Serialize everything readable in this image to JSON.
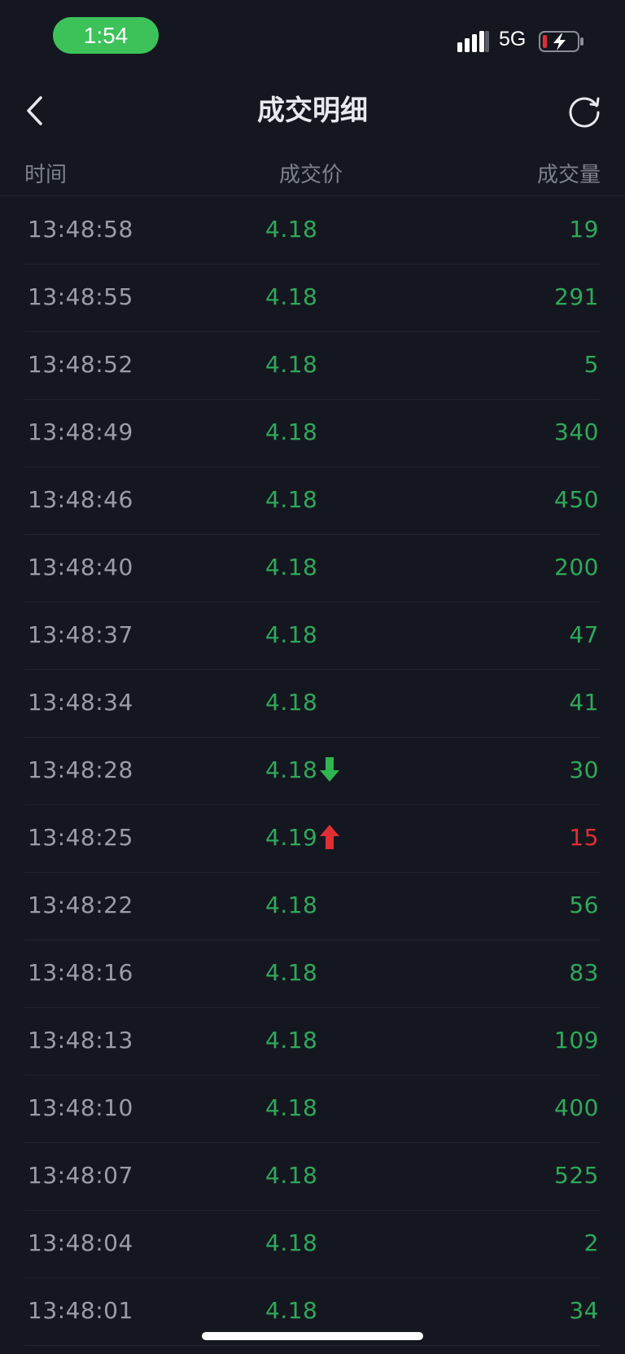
{
  "status_bar": {
    "time": "1:54",
    "network": "5G",
    "time_pill_color": "#3dc25a"
  },
  "nav": {
    "title": "成交明细",
    "back_icon": "chevron-left-icon",
    "refresh_icon": "refresh-icon"
  },
  "columns": {
    "time": "时间",
    "price": "成交价",
    "volume": "成交量"
  },
  "colors": {
    "background": "#151720",
    "down_green": "#2fa85a",
    "up_red": "#e02f34"
  },
  "trades": [
    {
      "time": "13:48:58",
      "price": "4.18",
      "volume": "19",
      "direction": "none",
      "volume_color": "green"
    },
    {
      "time": "13:48:55",
      "price": "4.18",
      "volume": "291",
      "direction": "none",
      "volume_color": "green"
    },
    {
      "time": "13:48:52",
      "price": "4.18",
      "volume": "5",
      "direction": "none",
      "volume_color": "green"
    },
    {
      "time": "13:48:49",
      "price": "4.18",
      "volume": "340",
      "direction": "none",
      "volume_color": "green"
    },
    {
      "time": "13:48:46",
      "price": "4.18",
      "volume": "450",
      "direction": "none",
      "volume_color": "green"
    },
    {
      "time": "13:48:40",
      "price": "4.18",
      "volume": "200",
      "direction": "none",
      "volume_color": "green"
    },
    {
      "time": "13:48:37",
      "price": "4.18",
      "volume": "47",
      "direction": "none",
      "volume_color": "green"
    },
    {
      "time": "13:48:34",
      "price": "4.18",
      "volume": "41",
      "direction": "none",
      "volume_color": "green"
    },
    {
      "time": "13:48:28",
      "price": "4.18",
      "volume": "30",
      "direction": "down",
      "volume_color": "green"
    },
    {
      "time": "13:48:25",
      "price": "4.19",
      "volume": "15",
      "direction": "up",
      "volume_color": "red"
    },
    {
      "time": "13:48:22",
      "price": "4.18",
      "volume": "56",
      "direction": "none",
      "volume_color": "green"
    },
    {
      "time": "13:48:16",
      "price": "4.18",
      "volume": "83",
      "direction": "none",
      "volume_color": "green"
    },
    {
      "time": "13:48:13",
      "price": "4.18",
      "volume": "109",
      "direction": "none",
      "volume_color": "green"
    },
    {
      "time": "13:48:10",
      "price": "4.18",
      "volume": "400",
      "direction": "none",
      "volume_color": "green"
    },
    {
      "time": "13:48:07",
      "price": "4.18",
      "volume": "525",
      "direction": "none",
      "volume_color": "green"
    },
    {
      "time": "13:48:04",
      "price": "4.18",
      "volume": "2",
      "direction": "none",
      "volume_color": "green"
    },
    {
      "time": "13:48:01",
      "price": "4.18",
      "volume": "34",
      "direction": "none",
      "volume_color": "green"
    }
  ]
}
